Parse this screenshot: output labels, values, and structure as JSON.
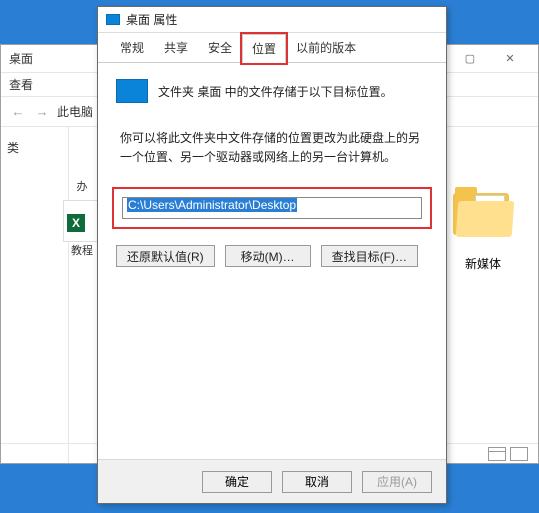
{
  "explorer": {
    "title": "桌面",
    "search_hint": "查看",
    "nav_path": "此电脑",
    "sidebar": {
      "header": "类"
    },
    "folder_label": "新媒体",
    "status": ""
  },
  "leftPreview": {
    "items": [
      "办",
      "教程"
    ]
  },
  "dialog": {
    "title": "桌面 属性",
    "tabs": {
      "general": "常规",
      "sharing": "共享",
      "security": "安全",
      "location": "位置",
      "previous": "以前的版本"
    },
    "line1": "文件夹 桌面 中的文件存储于以下目标位置。",
    "hint": "你可以将此文件夹中文件存储的位置更改为此硬盘上的另一个位置、另一个驱动器或网络上的另一台计算机。",
    "path": "C:\\Users\\Administrator\\Desktop",
    "buttons": {
      "restore": "还原默认值(R)",
      "move": "移动(M)…",
      "find": "查找目标(F)…"
    },
    "footer": {
      "ok": "确定",
      "cancel": "取消",
      "apply": "应用(A)"
    }
  }
}
